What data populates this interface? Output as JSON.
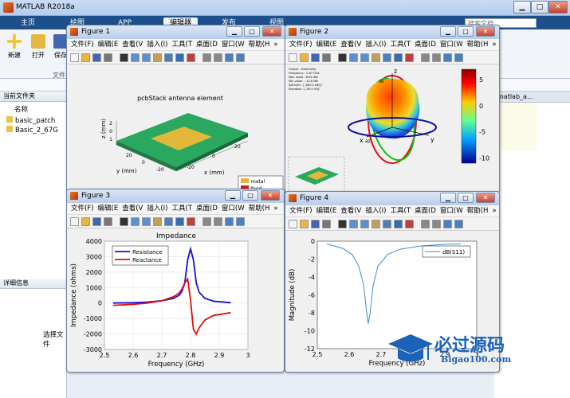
{
  "app": {
    "title": "MATLAB R2018a"
  },
  "tabs": [
    {
      "label": "主页"
    },
    {
      "label": "绘图"
    },
    {
      "label": "APP"
    },
    {
      "label": "编辑器"
    },
    {
      "label": "发布"
    },
    {
      "label": "视图"
    }
  ],
  "search": {
    "placeholder": "搜索文档"
  },
  "ribbon": {
    "buttons": [
      {
        "label": "新建",
        "icon": "new-file-icon"
      },
      {
        "label": "打开",
        "icon": "open-folder-icon"
      },
      {
        "label": "保存",
        "icon": "save-icon"
      }
    ],
    "group_label": "文件"
  },
  "current_folder": {
    "title": "当前文件夹",
    "column": "名称",
    "files": [
      "basic_patch",
      "Basic_2_67G"
    ]
  },
  "detail": {
    "title": "详细信息",
    "text": "选择文件"
  },
  "editor_tab": {
    "label": "matlab_a..."
  },
  "figures": {
    "fig1": {
      "title": "Figure 1"
    },
    "fig2": {
      "title": "Figure 2"
    },
    "fig3": {
      "title": "Figure 3"
    },
    "fig4": {
      "title": "Figure 4"
    }
  },
  "figure_menu": [
    "文件(F)",
    "编辑(E",
    "查看(V",
    "插入(I)",
    "工具(T",
    "桌面(D",
    "窗口(W",
    "帮助(H"
  ],
  "antenna_plot": {
    "title": "pcbStack antenna element",
    "xlabel": "x (mm)",
    "ylabel": "y (mm)",
    "zlabel": "z (mm)",
    "ticks_y": [
      "-20",
      "0",
      "20"
    ],
    "ticks_x": [
      "-20",
      "0",
      "20"
    ],
    "z_ticks": [
      "2",
      "0",
      "1"
    ],
    "legend": [
      "metal",
      "feed"
    ],
    "colors": {
      "metal": "#e3b83a",
      "feed": "#d11a1a",
      "substrate": "#2aa860"
    }
  },
  "pattern_plot": {
    "info_lines": [
      "Output : Directivity",
      "Frequency : 2.67 GHz",
      "Max value : 6.82 dBi",
      "Min value : -10.6 dBi",
      "Azimuth : [-180:1:180]°",
      "Elevation : [-90:1:90]°"
    ],
    "axes": [
      "z",
      "x",
      "y",
      "az",
      "el"
    ],
    "colorbar_ticks": [
      "5",
      "0",
      "-5",
      "-10"
    ],
    "colorbar_range": [
      -11,
      7
    ]
  },
  "chart_data": [
    {
      "type": "line",
      "title": "Impedance",
      "xlabel": "Frequency (GHz)",
      "ylabel": "Impedance (ohms)",
      "xlim": [
        2.5,
        3.0
      ],
      "ylim": [
        -3000,
        4000
      ],
      "xticks": [
        2.5,
        2.6,
        2.7,
        2.8,
        2.9,
        3
      ],
      "yticks": [
        -3000,
        -2000,
        -1000,
        0,
        1000,
        2000,
        3000,
        4000
      ],
      "grid": true,
      "legend_position": "top-left",
      "series": [
        {
          "name": "Resistance",
          "color": "#1010e0",
          "x": [
            2.53,
            2.6,
            2.65,
            2.7,
            2.74,
            2.76,
            2.77,
            2.78,
            2.79,
            2.8,
            2.81,
            2.82,
            2.83,
            2.85,
            2.88,
            2.94
          ],
          "y": [
            0,
            20,
            60,
            150,
            300,
            500,
            750,
            1300,
            2800,
            3500,
            2800,
            1300,
            700,
            300,
            120,
            20
          ]
        },
        {
          "name": "Reactance",
          "color": "#e01010",
          "x": [
            2.53,
            2.6,
            2.65,
            2.7,
            2.74,
            2.76,
            2.77,
            2.78,
            2.79,
            2.8,
            2.81,
            2.82,
            2.83,
            2.85,
            2.88,
            2.94
          ],
          "y": [
            -150,
            -80,
            0,
            150,
            400,
            650,
            900,
            1300,
            1550,
            200,
            -1700,
            -2000,
            -1600,
            -1100,
            -800,
            -620
          ]
        }
      ]
    },
    {
      "type": "line",
      "title": "",
      "xlabel": "Frequency (GHz)",
      "ylabel": "Magnitude (dB)",
      "xlim": [
        2.5,
        3.0
      ],
      "ylim": [
        -12,
        0
      ],
      "xticks": [
        2.5,
        2.6,
        2.7,
        2.8,
        2.9,
        3
      ],
      "yticks": [
        -12,
        -10,
        -8,
        -6,
        -4,
        -2,
        0
      ],
      "grid": false,
      "legend_position": "top-right",
      "series": [
        {
          "name": "dB(S11)",
          "color": "#3a8fc4",
          "x": [
            2.53,
            2.58,
            2.61,
            2.63,
            2.645,
            2.655,
            2.66,
            2.665,
            2.675,
            2.69,
            2.72,
            2.76,
            2.82,
            2.9,
            2.95
          ],
          "y": [
            -0.3,
            -0.8,
            -1.5,
            -2.8,
            -4.8,
            -8.0,
            -9.2,
            -8.2,
            -5.0,
            -2.8,
            -1.5,
            -0.9,
            -0.55,
            -0.35,
            -0.3
          ]
        }
      ]
    }
  ],
  "watermark": {
    "text": "必过源码",
    "url": "Bigao100.com"
  }
}
